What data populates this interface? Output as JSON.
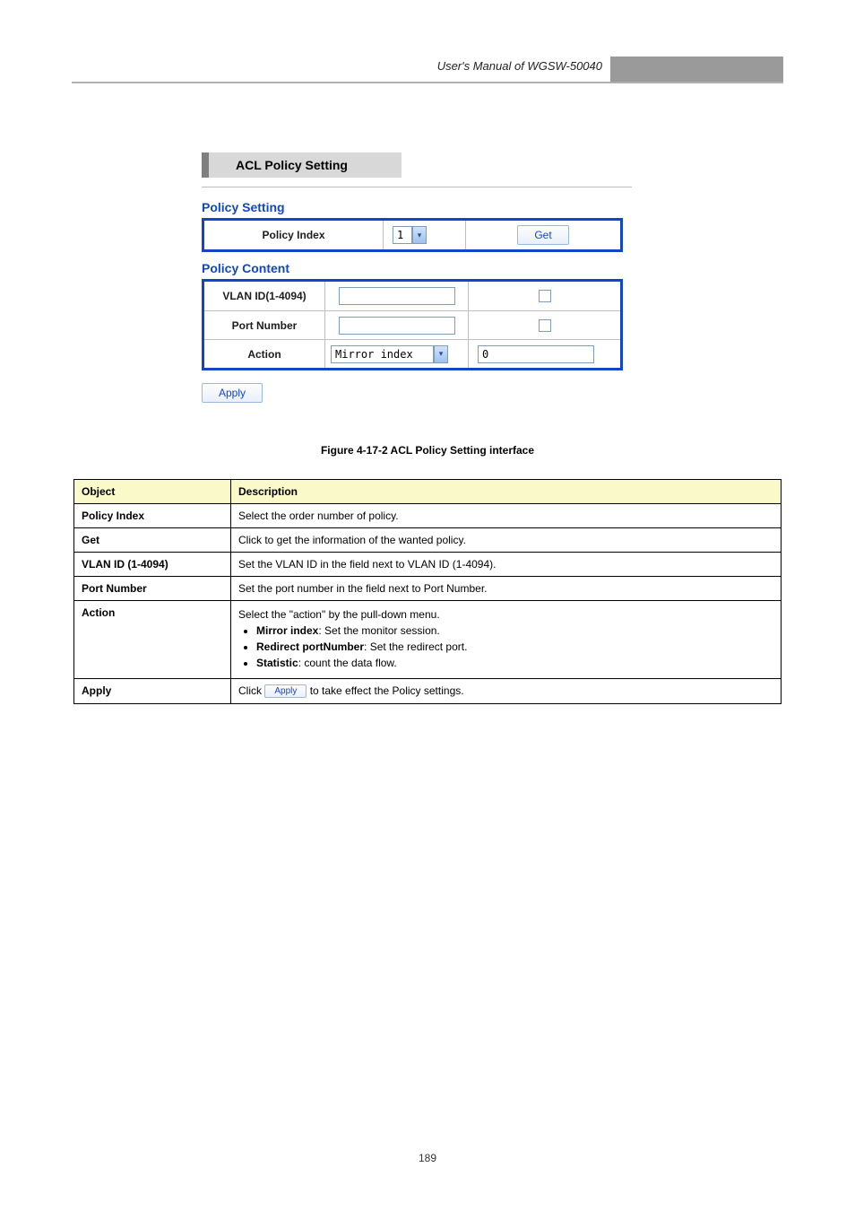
{
  "header": {
    "manual_title": "User's Manual of WGSW-50040"
  },
  "footer": {
    "page": "189"
  },
  "figure": {
    "title": "ACL Policy Setting",
    "caption": "Figure 4-17-2 ACL Policy Setting interface",
    "policy_setting": {
      "heading": "Policy Setting",
      "index_label": "Policy Index",
      "index_value": "1",
      "get_label": "Get"
    },
    "policy_content": {
      "heading": "Policy Content",
      "vlan_label": "VLAN ID(1-4094)",
      "vlan_value": "",
      "port_label": "Port Number",
      "port_value": "",
      "action_label": "Action",
      "action_select_value": "Mirror index",
      "action_num_value": "0"
    },
    "apply_label": "Apply"
  },
  "param_table": {
    "head_object": "Object",
    "head_description": "Description",
    "rows": [
      {
        "object": "Policy Index",
        "desc_plain": "Select the order number of policy."
      },
      {
        "object": "Get",
        "desc_plain": "Click to get the information of the wanted policy."
      },
      {
        "object": "VLAN ID (1-4094)",
        "desc_plain": "Set the VLAN ID in the field next to VLAN ID (1-4094)."
      },
      {
        "object": "Port Number",
        "desc_plain": "Set the port number in the field next to Port Number."
      },
      {
        "object": "Action",
        "desc_intro": "Select the \"action\" by the pull-down menu.",
        "desc_items": [
          {
            "label": "Mirror index",
            "text": ": Set the monitor session."
          },
          {
            "label": "Redirect portNumber",
            "text": ": Set the redirect port."
          },
          {
            "label": "Statistic",
            "text": ": count the data flow."
          }
        ]
      },
      {
        "object": "Apply",
        "desc_prefix": "Click ",
        "button_text": "Apply",
        "desc_suffix": " to take effect the Policy settings."
      }
    ]
  }
}
